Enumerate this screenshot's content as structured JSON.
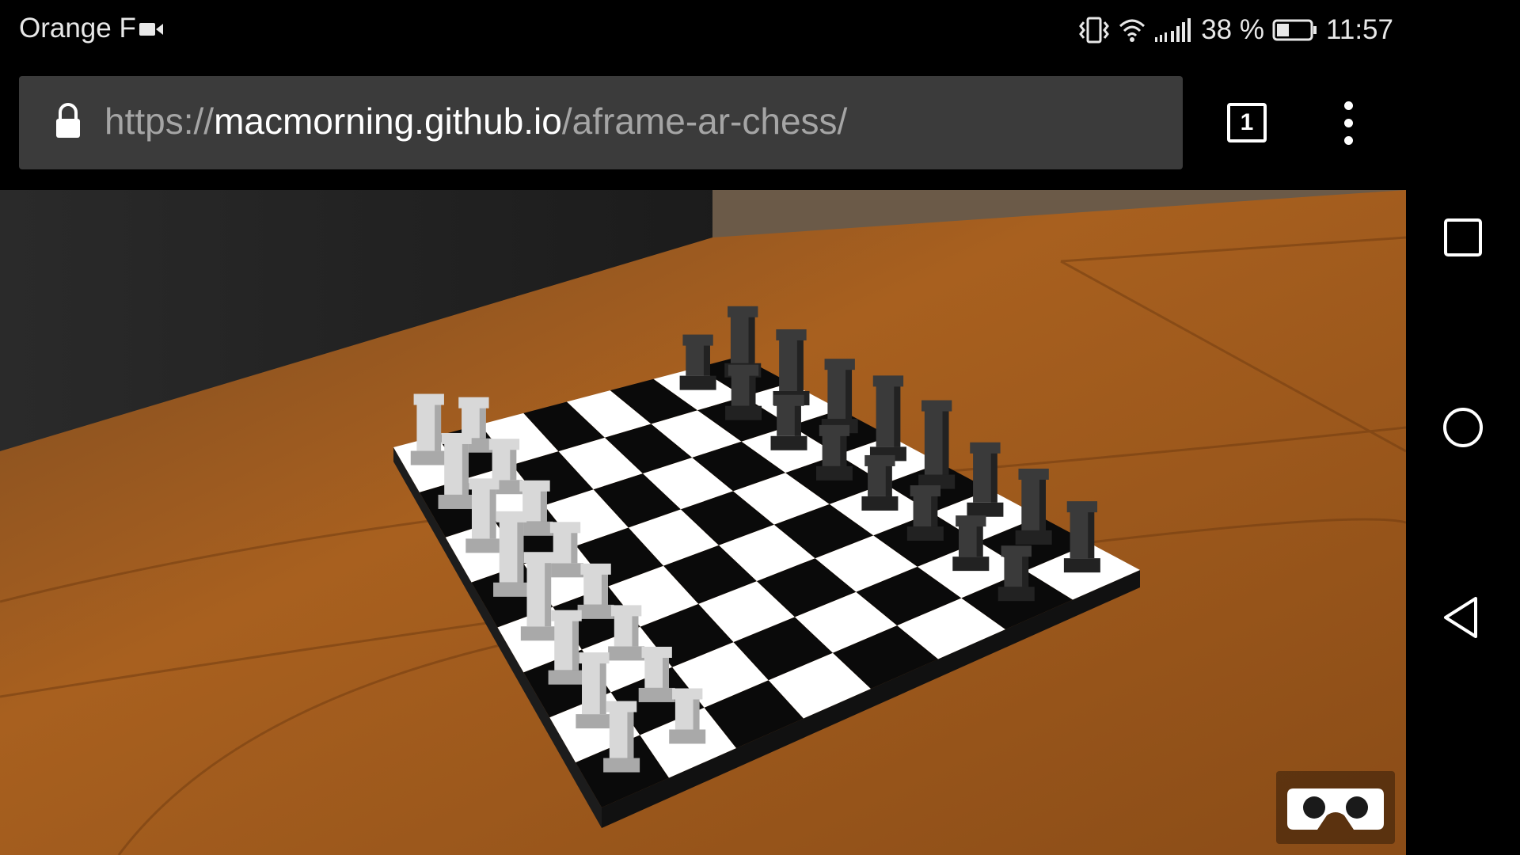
{
  "status_bar": {
    "carrier": "Orange F",
    "battery_percent": "38 %",
    "battery_level": 0.38,
    "time": "11:57",
    "icons": [
      "video-camera-icon",
      "vibrate-icon",
      "wifi-icon",
      "signal-icon",
      "battery-icon"
    ]
  },
  "browser": {
    "url_scheme": "https://",
    "url_host": "macmorning.github.io",
    "url_path": "/aframe-ar-chess/",
    "tab_count": "1",
    "icons": [
      "lock-icon",
      "tabs-icon",
      "overflow-menu-icon"
    ]
  },
  "scene": {
    "board_rows": 8,
    "board_cols": 8,
    "colors": {
      "table_wood": "#a05a1e",
      "light_square": "#ffffff",
      "dark_square": "#0a0a0a",
      "white_pieces": "#d8d8d8",
      "black_pieces": "#3a3a3a"
    },
    "vr_button_icon": "vr-goggles-icon"
  },
  "nav_bar": {
    "icons": [
      "recents-square-icon",
      "home-circle-icon",
      "back-triangle-icon"
    ]
  }
}
